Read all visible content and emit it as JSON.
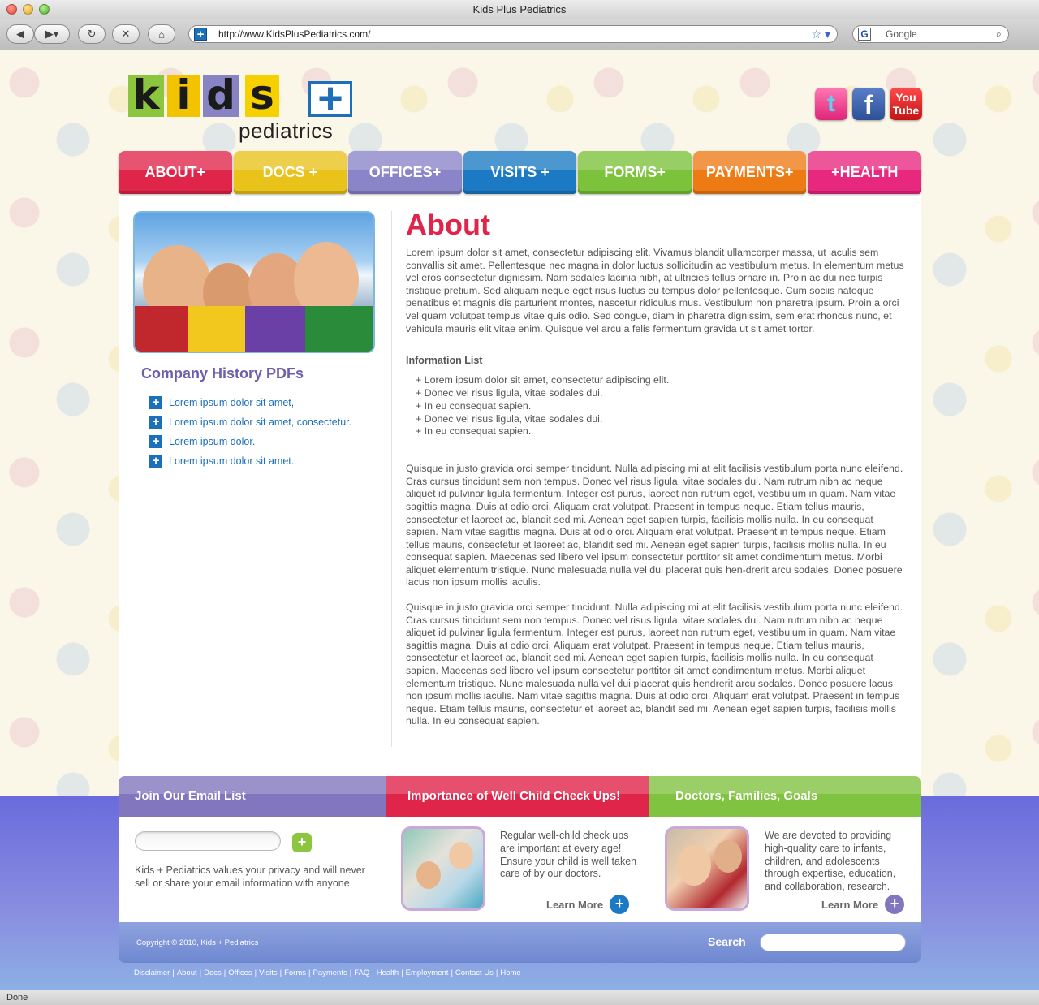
{
  "browser": {
    "window_title": "Kids Plus Pediatrics",
    "url": "http://www.KidsPlusPediatrics.com/",
    "search_placeholder": "Google",
    "status": "Done"
  },
  "header": {
    "logo_letters": [
      "k",
      "i",
      "d",
      "s"
    ],
    "logo_plus": "+",
    "logo_sub": "pediatrics",
    "social": {
      "twitter": "t",
      "facebook": "f",
      "youtube_top": "You",
      "youtube_bottom": "Tube"
    }
  },
  "nav": {
    "items": [
      {
        "label": "ABOUT+"
      },
      {
        "label": "DOCS +"
      },
      {
        "label": "OFFICES+"
      },
      {
        "label": "VISITS +"
      },
      {
        "label": "FORMS+"
      },
      {
        "label": "PAYMENTS+"
      },
      {
        "label": "+HEALTH"
      }
    ]
  },
  "sidebar": {
    "title": "Company History PDFs",
    "links": [
      "Lorem ipsum dolor sit amet,",
      "Lorem ipsum dolor sit amet, consectetur.",
      "Lorem ipsum dolor.",
      "Lorem ipsum dolor sit amet."
    ]
  },
  "main": {
    "heading": "About",
    "intro": "Lorem ipsum dolor sit amet, consectetur adipiscing elit. Vivamus blandit ullamcorper massa, ut iaculis sem convallis sit amet. Pellentesque nec magna in dolor luctus sollicitudin ac vestibulum metus. In elementum metus vel eros consectetur dignissim. Nam sodales lacinia nibh, at ultricies tellus ornare in. Proin ac dui nec turpis tristique pretium. Sed aliquam neque eget risus luctus eu tempus dolor pellentesque. Cum sociis natoque penatibus et magnis dis parturient montes, nascetur ridiculus mus. Vestibulum non pharetra ipsum. Proin a orci vel quam volutpat tempus vitae quis odio. Sed congue, diam in pharetra dignissim, sem erat rhoncus nunc, et vehicula mauris elit vitae enim. Quisque vel arcu a felis fermentum gravida ut sit amet tortor.",
    "info_title": "Information List",
    "info_items": [
      "+ Lorem ipsum dolor sit amet, consectetur adipiscing elit.",
      "+ Donec vel risus ligula, vitae sodales dui.",
      "+ In eu consequat sapien.",
      "+ Donec vel risus ligula, vitae sodales dui.",
      "+ In eu consequat sapien."
    ],
    "para2": "Quisque in justo gravida orci semper tincidunt. Nulla adipiscing mi at elit facilisis vestibulum porta nunc eleifend. Cras cursus tincidunt sem non tempus. Donec vel risus ligula, vitae sodales dui. Nam rutrum nibh ac neque aliquet id pulvinar ligula fermentum. Integer est purus, laoreet non rutrum eget, vestibulum in quam. Nam vitae sagittis magna. Duis at odio orci. Aliquam erat volutpat. Praesent in tempus neque. Etiam tellus mauris, consectetur et laoreet ac, blandit sed mi. Aenean eget sapien turpis, facilisis mollis nulla. In eu consequat sapien. Nam vitae sagittis magna. Duis at odio orci. Aliquam erat volutpat. Praesent in tempus neque. Etiam tellus mauris, consectetur et laoreet ac, blandit sed mi. Aenean eget sapien turpis, facilisis mollis nulla. In eu consequat sapien. Maecenas sed libero vel ipsum consectetur porttitor sit amet condimentum metus. Morbi aliquet elementum tristique. Nunc malesuada nulla vel dui placerat quis hen-drerit arcu sodales. Donec posuere lacus non ipsum mollis iaculis.",
    "para3": "Quisque in justo gravida orci semper tincidunt. Nulla adipiscing mi at elit facilisis vestibulum porta nunc eleifend. Cras cursus tincidunt sem non tempus. Donec vel risus ligula, vitae sodales dui. Nam rutrum nibh ac neque aliquet id pulvinar ligula fermentum. Integer est purus, laoreet non rutrum eget, vestibulum in quam. Nam vitae sagittis magna. Duis at odio orci. Aliquam erat volutpat. Praesent in tempus neque. Etiam tellus mauris, consectetur et laoreet ac, blandit sed mi. Aenean eget sapien turpis, facilisis mollis nulla. In eu consequat sapien. Maecenas sed libero vel ipsum consectetur porttitor sit amet condimentum metus. Morbi aliquet elementum tristique. Nunc malesuada nulla vel dui placerat quis hendrerit arcu sodales. Donec posuere lacus non ipsum mollis iaculis. Nam vitae sagittis magna. Duis at odio orci. Aliquam erat volutpat. Praesent in tempus neque. Etiam tellus mauris, consectetur et laoreet ac, blandit sed mi. Aenean eget sapien turpis, facilisis mollis nulla. In eu consequat sapien."
  },
  "footer": {
    "email_title": "Join Our Email List",
    "email_go": "+",
    "email_text": "Kids + Pediatrics values your privacy and will never sell or share your email information with anyone.",
    "checkups_title": "Importance of Well Child Check Ups!",
    "checkups_text": "Regular well-child check ups are important at every age! Ensure your child is well taken care of by our doctors.",
    "docs_title": "Doctors, Families, Goals",
    "docs_text": "We are devoted to providing high-quality care to infants, children, and adolescents through expertise, education, and collaboration, research.",
    "learn_more": "Learn More",
    "copyright": "Copyright © 2010, Kids + Pediatrics",
    "search_label": "Search",
    "links": [
      "Disclaimer",
      "About",
      "Docs",
      "Offices",
      "Visits",
      "Forms",
      "Payments",
      "FAQ",
      "Health",
      "Employment",
      "Contact Us",
      "Home"
    ]
  },
  "colors": {
    "about": "#e0254a",
    "docs": "#e9c21a",
    "offices": "#8a84c8",
    "visits": "#1c7ac4",
    "forms": "#7cc23a",
    "payments": "#ee7a14",
    "health": "#e8277e",
    "link": "#1c6fb8"
  }
}
